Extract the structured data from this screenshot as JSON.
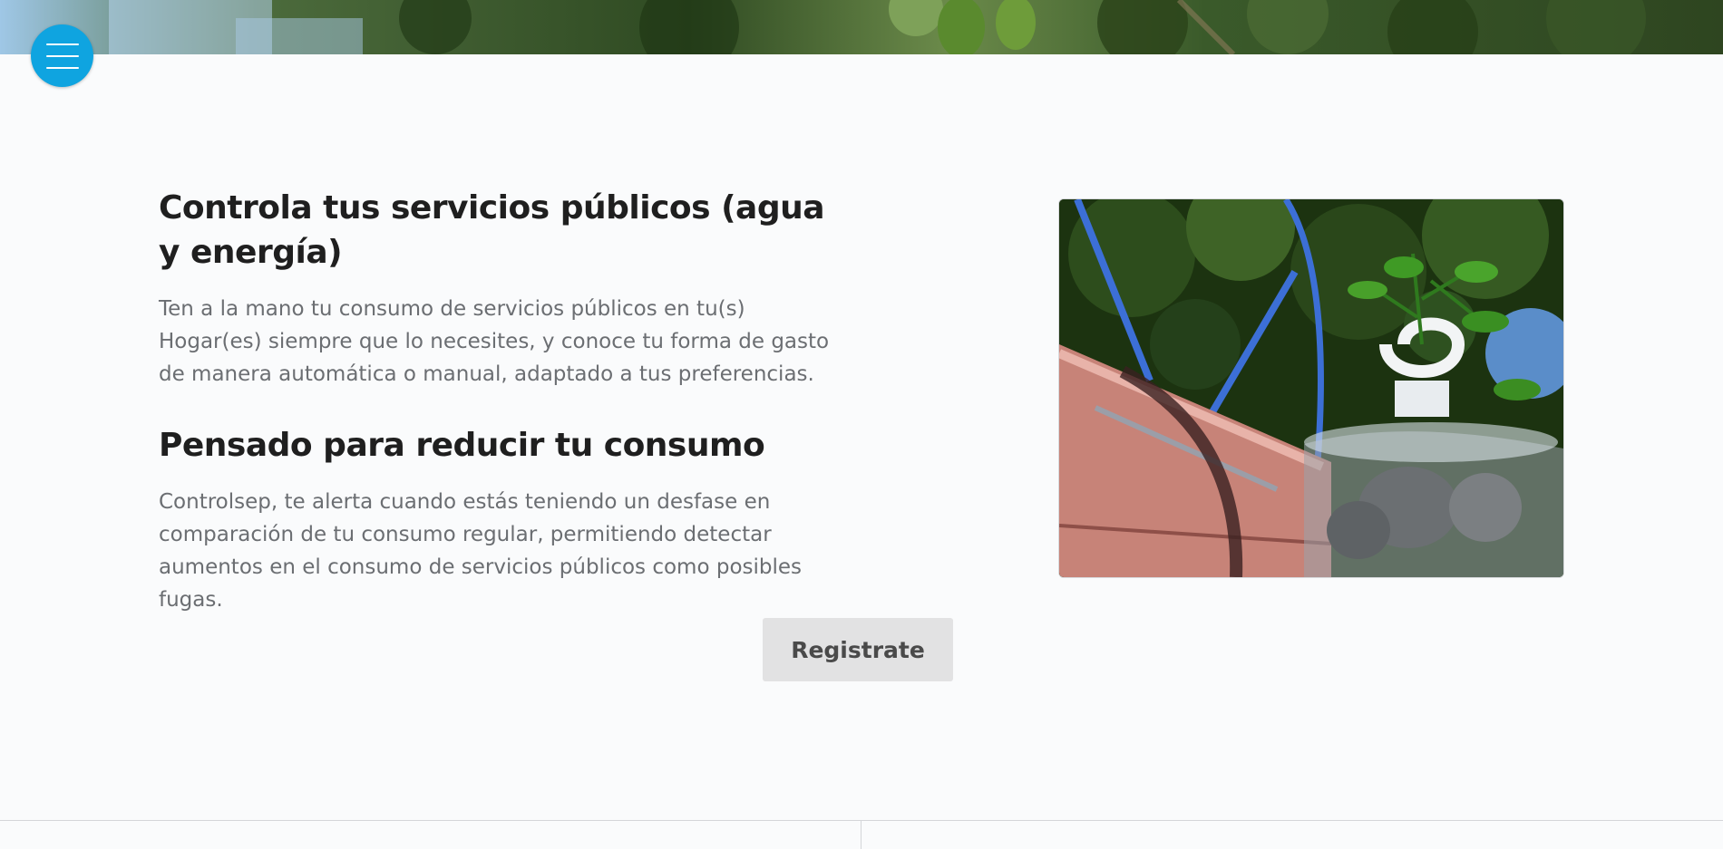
{
  "nav": {
    "menu_icon": "hamburger-icon"
  },
  "sections": [
    {
      "title": "Controla tus servicios públicos (agua y energía)",
      "text": "Ten a la mano tu consumo de servicios públicos en tu(s) Hogar(es) siempre que lo necesites, y conoce tu forma de gasto de manera automática o manual, adaptado a tus preferencias."
    },
    {
      "title": "Pensado para reducir tu consumo",
      "text": "Controlsep, te alerta cuando estás teniendo un desfase en comparación de tu consumo regular, permitiendo detectar aumentos en el consumo de servicios públicos como posibles fugas."
    }
  ],
  "cta": {
    "register_label": "Registrate"
  },
  "colors": {
    "accent": "#0fa4e0",
    "background": "#fafbfc",
    "heading": "#1f1f1f",
    "body_text": "#6b6e72",
    "button_bg": "#e2e2e3"
  }
}
